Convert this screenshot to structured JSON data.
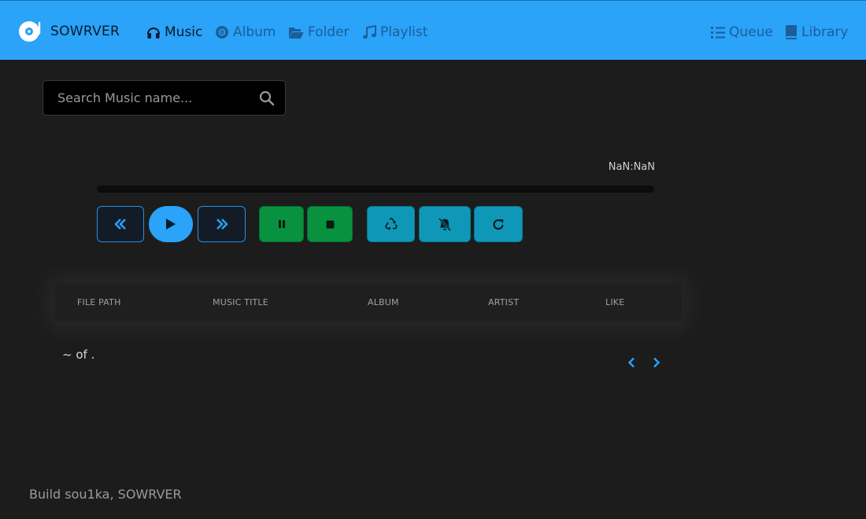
{
  "navbar": {
    "brand": "SOWRVER",
    "links": [
      {
        "label": "Music",
        "icon": "headphones-icon",
        "active": true
      },
      {
        "label": "Album",
        "icon": "disc-icon"
      },
      {
        "label": "Folder",
        "icon": "folder-open-icon"
      },
      {
        "label": "Playlist",
        "icon": "music-note-icon"
      }
    ],
    "right_links": [
      {
        "label": "Queue",
        "icon": "list-ordered-icon"
      },
      {
        "label": "Library",
        "icon": "book-icon"
      }
    ]
  },
  "search": {
    "placeholder": "Search Music name...",
    "value": ""
  },
  "player": {
    "time": "NaN:NaN",
    "progress": 0
  },
  "table": {
    "columns": [
      "FILE PATH",
      "MUSIC TITLE",
      "ALBUM",
      "ARTIST",
      "LIKE"
    ],
    "rows": []
  },
  "pagination": {
    "text": "~ of ."
  },
  "footer": {
    "text": "Build sou1ka, SOWRVER"
  },
  "colors": {
    "navbar": "#2aa3f8",
    "background": "#1c1c1c",
    "green": "#08923f",
    "teal": "#0f97b8",
    "accent": "#2aa3f8"
  }
}
